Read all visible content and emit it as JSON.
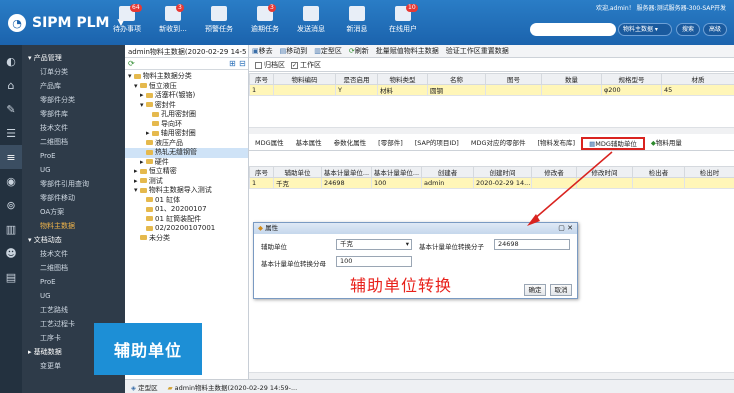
{
  "app": {
    "title": "SIPM PLM"
  },
  "topnav": {
    "items": [
      {
        "label": "待办事项",
        "badge": "64"
      },
      {
        "label": "新收到...",
        "badge": "3"
      },
      {
        "label": "预警任务",
        "badge": ""
      },
      {
        "label": "逾期任务",
        "badge": "3"
      },
      {
        "label": "发送消息",
        "badge": ""
      },
      {
        "label": "新消息",
        "badge": ""
      },
      {
        "label": "在线用户",
        "badge": "10"
      }
    ],
    "user_text": "欢迎,admin！ 服务器:测试服务器-300-SAP开发",
    "search_scope": "物料主数据",
    "search_btn": "搜索",
    "advanced_btn": "高级"
  },
  "sidebar": {
    "groups": [
      {
        "label": "产品管理",
        "items": [
          "订单分类",
          "产品库",
          "零部件分类",
          "零部件库",
          "技术文件",
          "二维图档",
          "ProE",
          "UG",
          "零部件引用查询",
          "零部件移动",
          "OA方案",
          "物料主数据"
        ]
      },
      {
        "label": "文档动态",
        "items": [
          "技术文件",
          "二维图档",
          "ProE",
          "UG",
          "工艺路线",
          "工艺过程卡",
          "工序卡"
        ]
      },
      {
        "label": "基础数据",
        "items": [
          "变更单"
        ]
      }
    ],
    "selected": "物料主数据"
  },
  "tree": {
    "header": "admin物料主数据(2020-02-29 14-5",
    "nodes": [
      {
        "label": "物料主数据分类",
        "level": 0
      },
      {
        "label": "恒立液压",
        "level": 1
      },
      {
        "label": "活塞杆(镀铬)",
        "level": 2
      },
      {
        "label": "密封件",
        "level": 2
      },
      {
        "label": "孔用密封圈",
        "level": 3
      },
      {
        "label": "导向环",
        "level": 3
      },
      {
        "label": "轴用密封圈",
        "level": 3
      },
      {
        "label": "液压产品",
        "level": 2
      },
      {
        "label": "热轧无缝钢管",
        "level": 2
      },
      {
        "label": "硬件",
        "level": 2
      },
      {
        "label": "恒立精密",
        "level": 1
      },
      {
        "label": "测试",
        "level": 1
      },
      {
        "label": "物料主数据导入测试",
        "level": 1
      },
      {
        "label": "01 缸体",
        "level": 2
      },
      {
        "label": "01、20200107",
        "level": 2
      },
      {
        "label": "01 缸筒装配件",
        "level": 2
      },
      {
        "label": "02/20200107001",
        "level": 2
      },
      {
        "label": "未分类",
        "level": 1
      }
    ],
    "selected": "热轧无缝钢管"
  },
  "toolbar": {
    "items": [
      "移去",
      "移动到",
      "定型区",
      "刷新",
      "批量赋值物料主数据",
      "验证工作区重置数据"
    ]
  },
  "subbar": {
    "archive_label": "归档区",
    "work_label": "工作区"
  },
  "main_grid": {
    "headers": [
      "序号",
      "物料编码",
      "是否启用",
      "物料类型",
      "名称",
      "图号",
      "数量",
      "规格型号",
      "材质"
    ],
    "rows": [
      [
        "1",
        "",
        "Y",
        "材料",
        "圆钢",
        "",
        "",
        "φ200",
        "45"
      ]
    ]
  },
  "tabs": {
    "items": [
      "MDG属性",
      "基本属性",
      "参数化属性",
      "[零部件]",
      "[SAP的项目ID]",
      "MDG对应的零部件",
      "[物料发布库]",
      "MDG辅助单位",
      "物料用量"
    ],
    "active": "MDG辅助单位"
  },
  "sub_grid": {
    "headers": [
      "序号",
      "辅助单位",
      "基本计量单位...",
      "基本计量单位...",
      "创建者",
      "创建时间",
      "修改者",
      "修改时间",
      "检出者",
      "检出时"
    ],
    "rows": [
      [
        "1",
        "千克",
        "24698",
        "100",
        "admin",
        "2020-02-29 14...",
        "",
        "",
        "",
        ""
      ]
    ]
  },
  "dialog": {
    "title": "属性",
    "aux_unit_label": "辅助单位",
    "aux_unit_value": "千克",
    "numerator_label": "基本计量单位转换分子",
    "numerator_value": "24698",
    "denominator_label": "基本计量单位转换分母",
    "denominator_value": "100",
    "ok": "确定",
    "cancel": "取消"
  },
  "annotation": {
    "red_text": "辅助单位转换",
    "blue_box": "辅助单位"
  },
  "bottom_tabs": [
    "定型区",
    "admin物料主数据(2020-02-29 14:59-..."
  ]
}
